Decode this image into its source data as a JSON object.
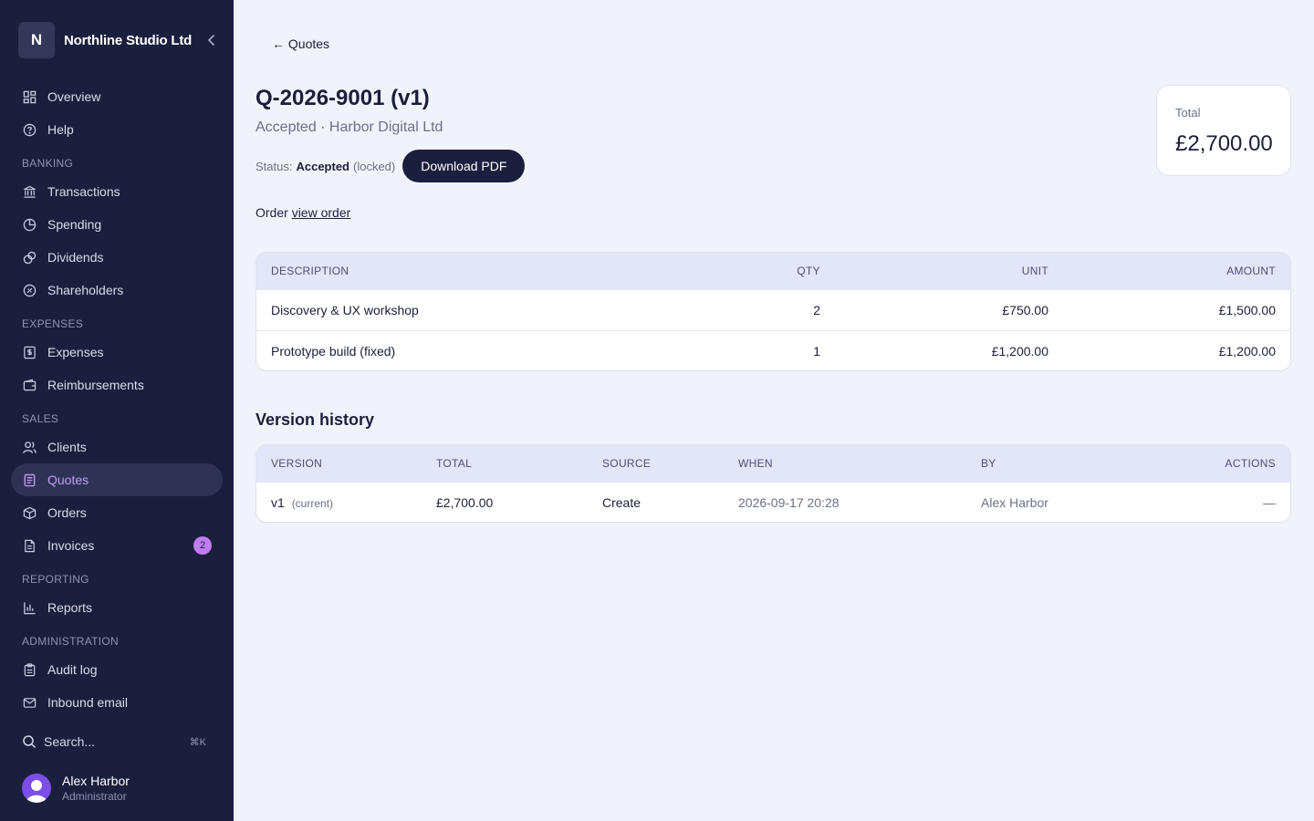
{
  "sidebar": {
    "brand_initial": "N",
    "brand_name": "Northline Studio Ltd",
    "items": [
      {
        "label": "Overview",
        "icon": "grid-icon"
      },
      {
        "label": "Help",
        "icon": "help-circle-icon"
      },
      {
        "label": "Transactions",
        "icon": "bank-icon"
      },
      {
        "label": "Spending",
        "icon": "pie-chart-icon"
      },
      {
        "label": "Dividends",
        "icon": "coins-icon"
      },
      {
        "label": "Shareholders",
        "icon": "shareholders-icon"
      },
      {
        "label": "Expenses",
        "icon": "receipt-dollar-icon"
      },
      {
        "label": "Reimbursements",
        "icon": "wallet-icon"
      },
      {
        "label": "Clients",
        "icon": "users-icon"
      },
      {
        "label": "Quotes",
        "icon": "quote-doc-icon"
      },
      {
        "label": "Orders",
        "icon": "package-icon"
      },
      {
        "label": "Invoices",
        "icon": "file-text-icon",
        "badge": "2"
      },
      {
        "label": "Reports",
        "icon": "bar-chart-icon"
      },
      {
        "label": "Audit log",
        "icon": "clipboard-icon"
      },
      {
        "label": "Inbound email",
        "icon": "mail-icon"
      }
    ],
    "sections": [
      "BANKING",
      "EXPENSES",
      "SALES",
      "REPORTING",
      "ADMINISTRATION"
    ],
    "active_item": "Quotes",
    "search_placeholder": "Search...",
    "search_shortcut": "⌘K",
    "user": {
      "name": "Alex Harbor",
      "role": "Administrator"
    }
  },
  "main": {
    "back_label": "← Quotes",
    "title": "Q-2026-9001 (v1)",
    "subtitle": "Accepted · Harbor Digital Ltd",
    "status_prefix": "Status:",
    "status_value": "Accepted",
    "status_suffix": "(locked)",
    "download_label": "Download PDF",
    "order_prefix": "Order",
    "order_link": "view order",
    "total_label": "Total",
    "total_value": "£2,700.00",
    "items_table": {
      "headers": [
        "DESCRIPTION",
        "QTY",
        "UNIT",
        "AMOUNT"
      ],
      "rows": [
        {
          "description": "Discovery & UX workshop",
          "qty": "2",
          "unit": "£750.00",
          "amount": "£1,500.00"
        },
        {
          "description": "Prototype build (fixed)",
          "qty": "1",
          "unit": "£1,200.00",
          "amount": "£1,200.00"
        }
      ]
    },
    "history_title": "Version history",
    "history_table": {
      "headers": [
        "VERSION",
        "TOTAL",
        "SOURCE",
        "WHEN",
        "BY",
        "ACTIONS"
      ],
      "rows": [
        {
          "version": "v1",
          "tag": "(current)",
          "total": "£2,700.00",
          "source": "Create",
          "when": "2026-09-17 20:28",
          "by": "Alex Harbor",
          "actions": "—"
        }
      ]
    }
  },
  "colors": {
    "sidebar_bg": "#1b1f3e",
    "page_bg": "#f1f3fb",
    "accent": "#c49cf5",
    "table_header_bg": "#e3e6f9",
    "badge_bg": "#c27cf1"
  }
}
